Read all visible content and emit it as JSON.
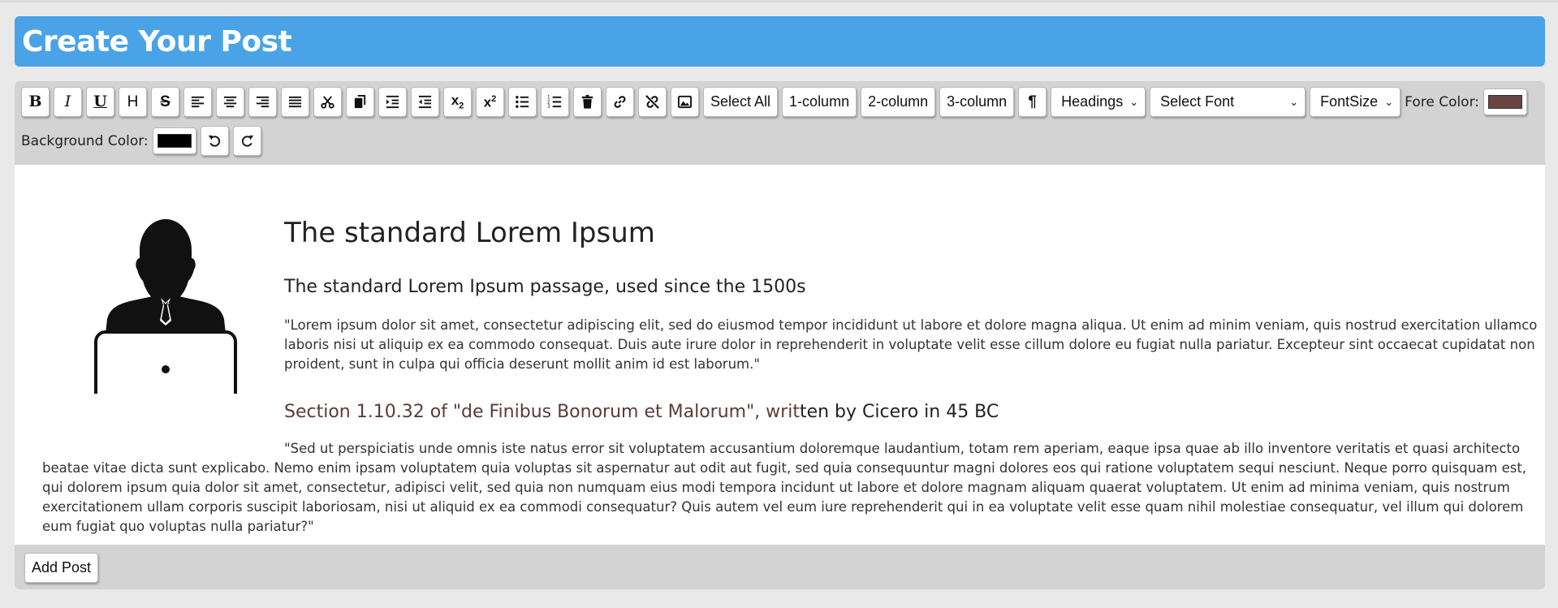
{
  "header": {
    "title": "Create Your Post"
  },
  "toolbar": {
    "heading_letter": "H",
    "select_all_label": "Select All",
    "one_column_label": "1-column",
    "two_column_label": "2-column",
    "three_column_label": "3-column",
    "headings_select": {
      "value": "Headings"
    },
    "font_select": {
      "value": "Select Font"
    },
    "fontsize_select": {
      "value": "FontSize"
    },
    "fore_color_label": "Fore Color:",
    "background_color_label": "Background Color:",
    "colors": {
      "fore": "#6b4444",
      "background": "#000000"
    }
  },
  "content": {
    "title": "The standard Lorem Ipsum",
    "subtitle": "The standard Lorem Ipsum passage, used since the 1500s",
    "paragraph1": "\"Lorem ipsum dolor sit amet, consectetur adipiscing elit, sed do eiusmod tempor incididunt ut labore et dolore magna aliqua. Ut enim ad minim veniam, quis nostrud exercitation ullamco laboris nisi ut aliquip ex ea commodo consequat. Duis aute irure dolor in reprehenderit in voluptate velit esse cillum dolore eu fugiat nulla pariatur. Excepteur sint occaecat cupidatat non proident, sunt in culpa qui officia deserunt mollit anim id est laborum.\"",
    "section_heading_colored": "Section 1.10.32 of \"de Finibus Bonorum et Malorum\", writ",
    "section_heading_rest": "ten by Cicero in 45 BC",
    "paragraph2": "\"Sed ut perspiciatis unde omnis iste natus error sit voluptatem accusantium doloremque laudantium, totam rem aperiam, eaque ipsa quae ab illo inventore veritatis et quasi architecto beatae vitae dicta sunt explicabo. Nemo enim ipsam voluptatem quia voluptas sit aspernatur aut odit aut fugit, sed quia consequuntur magni dolores eos qui ratione voluptatem sequi nesciunt. Neque porro quisquam est, qui dolorem ipsum quia dolor sit amet, consectetur, adipisci velit, sed quia non numquam eius modi tempora incidunt ut labore et dolore magnam aliquam quaerat voluptatem. Ut enim ad minima veniam, quis nostrum exercitationem ullam corporis suscipit laboriosam, nisi ut aliquid ex ea commodi consequatur? Quis autem vel eum iure reprehenderit qui in ea voluptate velit esse quam nihil molestiae consequatur, vel illum qui dolorem eum fugiat quo voluptas nulla pariatur?\"",
    "image_icon": "person-laptop-icon"
  },
  "footer": {
    "add_post_label": "Add Post"
  }
}
